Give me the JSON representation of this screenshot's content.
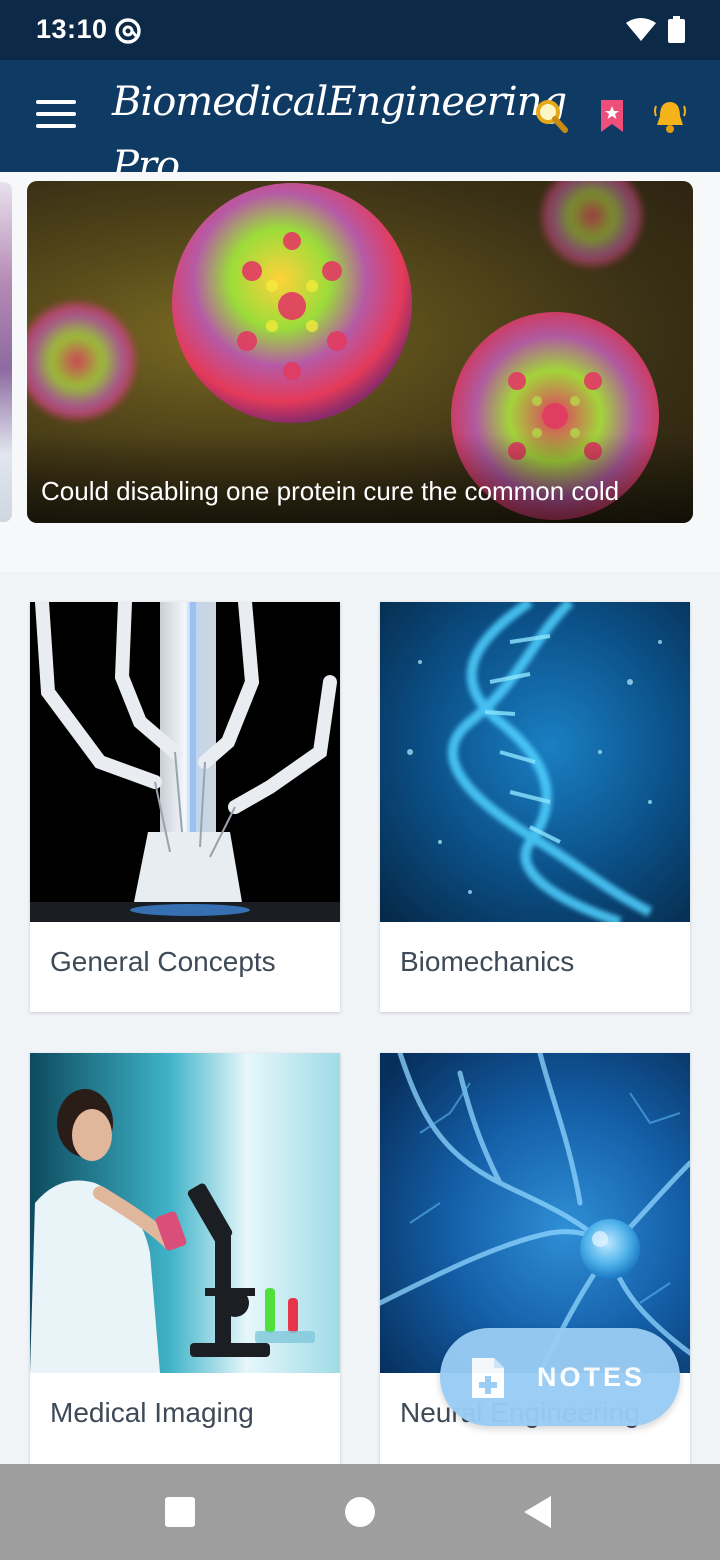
{
  "status_bar": {
    "time": "13:10",
    "icons": [
      "sync-icon",
      "wifi-icon",
      "battery-icon"
    ]
  },
  "app_bar": {
    "title": "BiomedicalEngineering Pro",
    "icons": [
      "menu-icon",
      "search-icon",
      "bookmark-icon",
      "notification-bell-icon"
    ],
    "bg_color": "#0f3a63"
  },
  "carousel": {
    "current": {
      "caption": "Could disabling one protein cure the common cold",
      "image": "virus-particles"
    }
  },
  "categories": [
    {
      "label": "General Concepts",
      "image": "surgical-robot"
    },
    {
      "label": "Biomechanics",
      "image": "dna-helix"
    },
    {
      "label": "Medical Imaging",
      "image": "scientist-microscope"
    },
    {
      "label": "Neural Engineering",
      "image": "neurons"
    }
  ],
  "fab": {
    "label": "NOTES",
    "icon": "add-note-icon",
    "color": "#99ccf4"
  },
  "nav_bar": {
    "buttons": [
      "recents-button",
      "home-button",
      "back-button"
    ]
  }
}
